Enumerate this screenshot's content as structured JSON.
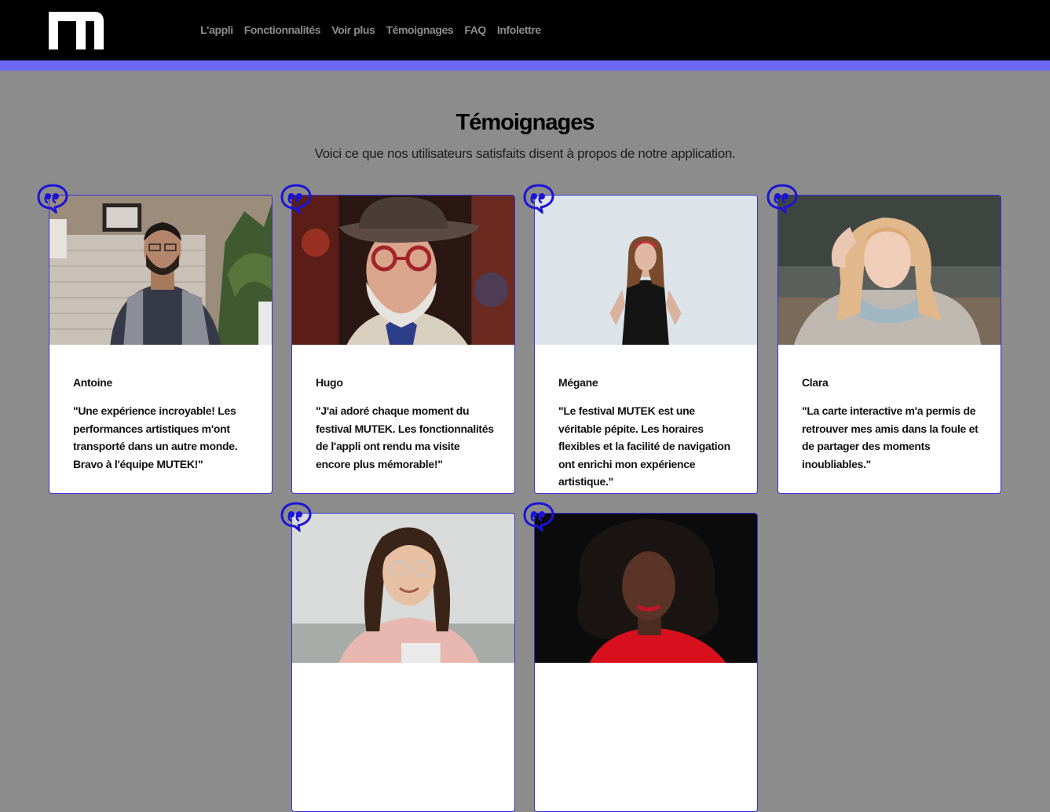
{
  "nav": {
    "items": [
      {
        "label": "L'appli"
      },
      {
        "label": "Fonctionnalités"
      },
      {
        "label": "Voir plus"
      },
      {
        "label": "Témoignages"
      },
      {
        "label": "FAQ"
      },
      {
        "label": "Infolettre"
      }
    ]
  },
  "colors": {
    "accent": "#6e6af5",
    "card_border": "#3a2fd6",
    "quote_icon": "#1b14d6",
    "page_bg": "#8c8c8c"
  },
  "section": {
    "title": "Témoignages",
    "subtitle": "Voici ce que nos utilisateurs satisfaits disent à propos de notre application."
  },
  "testimonials": [
    {
      "name": "Antoine",
      "quote": "\"Une expérience incroyable! Les performances artistiques m'ont transporté dans un autre monde. Bravo à l'équipe MUTEK!\""
    },
    {
      "name": "Hugo",
      "quote": "\"J'ai adoré chaque moment du festival MUTEK. Les fonctionnalités de l'appli ont rendu ma visite encore plus mémorable!\""
    },
    {
      "name": "Mégane",
      "quote": "\"Le festival MUTEK est une véritable pépite. Les horaires flexibles et la facilité de navigation ont enrichi mon expérience artistique.\""
    },
    {
      "name": "Clara",
      "quote": "\"La carte interactive m'a permis de retrouver mes amis dans la foule et de partager des moments inoubliables.\""
    },
    {
      "name": "",
      "quote": ""
    },
    {
      "name": "",
      "quote": ""
    }
  ]
}
